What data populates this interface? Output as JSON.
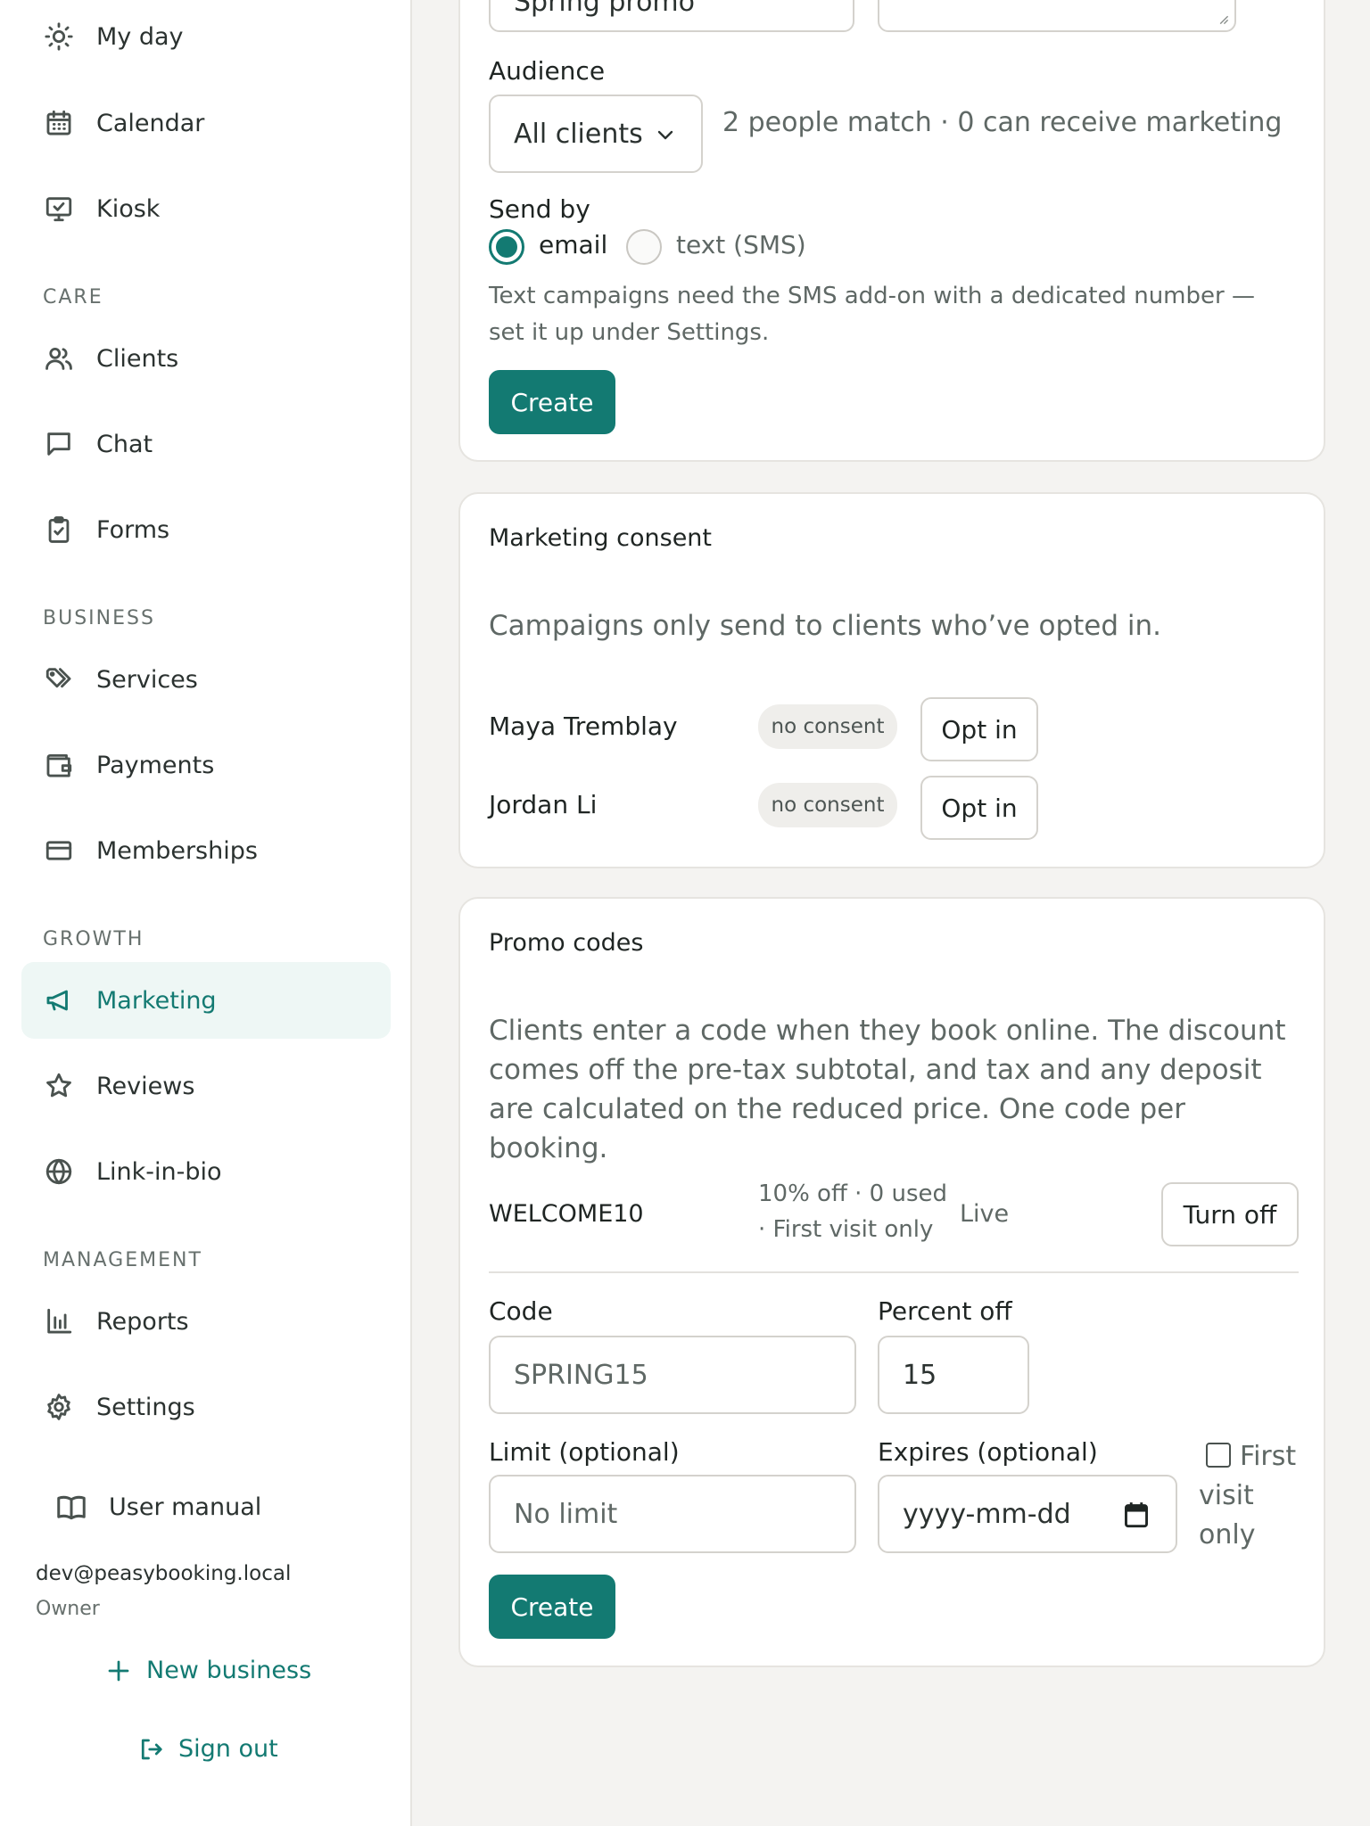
{
  "sidebar": {
    "items": [
      {
        "label": "My day",
        "icon": "sun-icon"
      },
      {
        "label": "Calendar",
        "icon": "calendar-icon"
      },
      {
        "label": "Kiosk",
        "icon": "kiosk-icon"
      },
      {
        "label": "Clients",
        "icon": "users-icon"
      },
      {
        "label": "Chat",
        "icon": "chat-icon"
      },
      {
        "label": "Forms",
        "icon": "clipboard-icon"
      },
      {
        "label": "Services",
        "icon": "tags-icon"
      },
      {
        "label": "Payments",
        "icon": "wallet-icon"
      },
      {
        "label": "Memberships",
        "icon": "card-icon"
      },
      {
        "label": "Marketing",
        "icon": "megaphone-icon",
        "active": true
      },
      {
        "label": "Reviews",
        "icon": "star-icon"
      },
      {
        "label": "Link-in-bio",
        "icon": "globe-icon"
      },
      {
        "label": "Reports",
        "icon": "bar-chart-icon"
      },
      {
        "label": "Settings",
        "icon": "gear-icon"
      }
    ],
    "sections": {
      "care": "CARE",
      "business": "BUSINESS",
      "growth": "GROWTH",
      "management": "MANAGEMENT"
    },
    "user_manual": "User manual",
    "user_email": "dev@peasybooking.local",
    "user_role": "Owner",
    "new_business": "New business",
    "sign_out": "Sign out"
  },
  "campaign": {
    "name_value": "Spring promo",
    "audience_label": "Audience",
    "audience_value": "All clients",
    "audience_match": "2 people match · 0 can receive marketing",
    "send_by_label": "Send by",
    "option_email": "email",
    "option_sms": "text (SMS)",
    "selected": "email",
    "sms_note": "Text campaigns need the SMS add-on with a dedicated number — set it up under Settings.",
    "create_label": "Create"
  },
  "consent": {
    "title": "Marketing consent",
    "description": "Campaigns only send to clients who’ve opted in.",
    "clients": [
      {
        "name": "Maya Tremblay",
        "status": "no consent",
        "action": "Opt in"
      },
      {
        "name": "Jordan Li",
        "status": "no consent",
        "action": "Opt in"
      }
    ]
  },
  "promo": {
    "title": "Promo codes",
    "description": "Clients enter a code when they book online. The discount comes off the pre-tax subtotal, and tax and any deposit are calculated on the reduced price. One code per booking.",
    "codes": [
      {
        "code": "WELCOME10",
        "detail_line1": "10% off · 0 used",
        "detail_line2": "· First visit only",
        "status": "Live",
        "action": "Turn off"
      }
    ],
    "form": {
      "code_label": "Code",
      "code_placeholder": "SPRING15",
      "percent_label": "Percent off",
      "percent_value": "15",
      "limit_label": "Limit (optional)",
      "limit_placeholder": "No limit",
      "expires_label": "Expires (optional)",
      "expires_placeholder": "yyyy-mm-dd",
      "first_visit_label": "First visit only",
      "create_label": "Create"
    }
  },
  "colors": {
    "accent": "#137a72",
    "active_bg": "#eef7f5",
    "page_bg": "#f4f3f1",
    "border": "#d4d2cd"
  }
}
